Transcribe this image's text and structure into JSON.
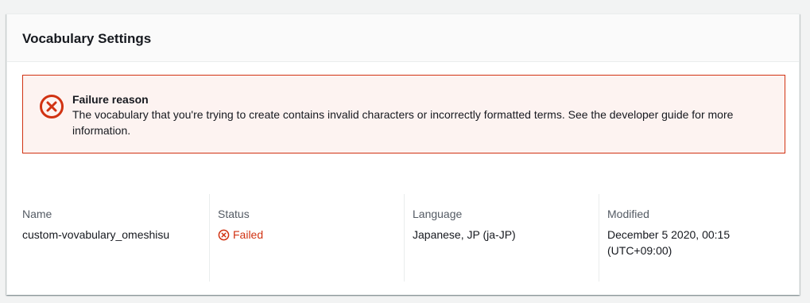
{
  "panel": {
    "title": "Vocabulary Settings"
  },
  "alert": {
    "icon": "error-x-circle-icon",
    "title": "Failure reason",
    "message": "The vocabulary that you're trying to create contains invalid characters or incorrectly formatted terms. See the developer guide for more information."
  },
  "details": {
    "name": {
      "label": "Name",
      "value": "custom-vovabulary_omeshisu"
    },
    "status": {
      "label": "Status",
      "value": "Failed",
      "icon": "error-x-circle-icon",
      "color": "#d13212"
    },
    "language": {
      "label": "Language",
      "value": "Japanese, JP (ja-JP)"
    },
    "modified": {
      "label": "Modified",
      "value": "December 5 2020, 00:15 (UTC+09:00)"
    }
  },
  "colors": {
    "error": "#d13212",
    "alert_background": "#fdf3f1",
    "header_background": "#fafafa",
    "label_text": "#545b64"
  }
}
